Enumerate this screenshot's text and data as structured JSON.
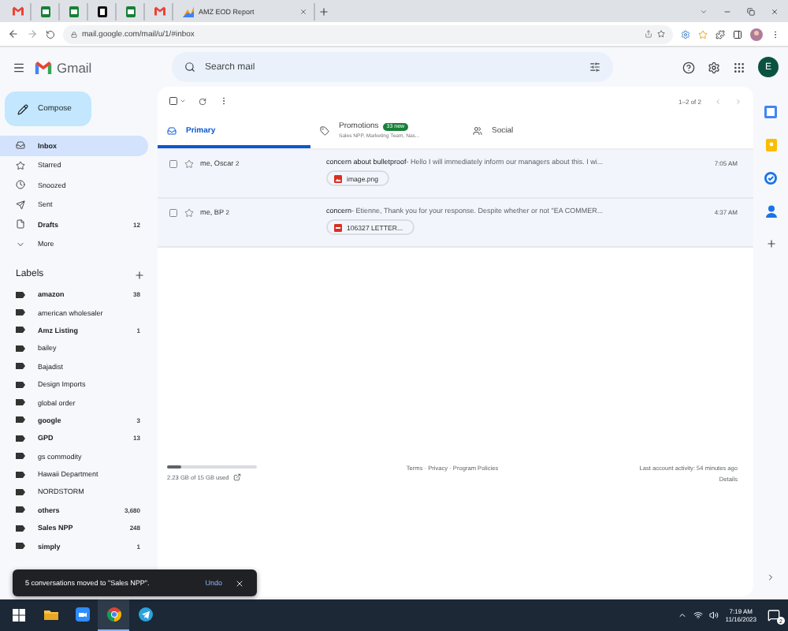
{
  "browser": {
    "tabs": [
      {
        "kind": "gmail"
      },
      {
        "kind": "sheets"
      },
      {
        "kind": "sheets"
      },
      {
        "kind": "notion"
      },
      {
        "kind": "sheets"
      },
      {
        "kind": "gmail"
      },
      {
        "kind": "report",
        "title": "AMZ EOD Report"
      }
    ],
    "url": "mail.google.com/mail/u/1/#inbox"
  },
  "header": {
    "product": "Gmail",
    "search": {
      "placeholder": "Search mail"
    },
    "avatar": "E"
  },
  "compose": "Compose",
  "nav": [
    {
      "kind": "inbox",
      "label": "Inbox",
      "selected": true,
      "unread": true
    },
    {
      "kind": "starred",
      "label": "Starred",
      "selected": false,
      "unread": false
    },
    {
      "kind": "snoozed",
      "label": "Snoozed",
      "selected": false,
      "unread": false
    },
    {
      "kind": "sent",
      "label": "Sent",
      "selected": false,
      "unread": false
    },
    {
      "kind": "drafts",
      "label": "Drafts",
      "count": "12",
      "selected": false,
      "unread": true
    },
    {
      "kind": "more",
      "label": "More",
      "selected": false,
      "unread": false
    }
  ],
  "labels_title": "Labels",
  "labels": [
    {
      "name": "amazon",
      "count": "38",
      "unread": true
    },
    {
      "name": "american wholesaler",
      "unread": false
    },
    {
      "name": "Amz Listing",
      "count": "1",
      "unread": true
    },
    {
      "name": "bailey",
      "unread": false
    },
    {
      "name": "Bajadist",
      "unread": false
    },
    {
      "name": "Design Imports",
      "unread": false
    },
    {
      "name": "global order",
      "unread": false
    },
    {
      "name": "google",
      "count": "3",
      "unread": true
    },
    {
      "name": "GPD",
      "count": "13",
      "unread": true
    },
    {
      "name": "gs commodity",
      "unread": false
    },
    {
      "name": "Hawaii Department",
      "unread": false
    },
    {
      "name": "NORDSTORM",
      "unread": false
    },
    {
      "name": "others",
      "count": "3,680",
      "unread": true
    },
    {
      "name": "Sales NPP",
      "count": "248",
      "unread": true
    },
    {
      "name": "simply",
      "count": "1",
      "unread": true
    }
  ],
  "pagination": "1–2 of 2",
  "inbox_tabs": [
    {
      "kind": "primary",
      "label": "Primary",
      "selected": true
    },
    {
      "kind": "promotions",
      "label": "Promotions",
      "badge": "33 new",
      "subtitle": "Sales NPP, Marketing Team, Nas...",
      "selected": false
    },
    {
      "kind": "social",
      "label": "Social",
      "selected": false
    }
  ],
  "emails": [
    {
      "sender": "me, Oscar",
      "count": "2",
      "subject": "concern about bulletproof",
      "snippet": " - Hello I will immediately inform our managers about this. I wi...",
      "time": "7:05 AM",
      "attachment": {
        "kind": "image",
        "name": "image.png"
      }
    },
    {
      "sender": "me, BP",
      "count": "2",
      "subject": "concern",
      "snippet": " - Etienne, Thank you for your response. Despite whether or not \"EA COMMER...",
      "time": "4:37 AM",
      "attachment": {
        "kind": "pdf",
        "name": "106327 LETTER..."
      }
    }
  ],
  "storage": {
    "level": 0.15,
    "text": "2.23 GB of 15 GB used"
  },
  "footer": {
    "links": "Terms · Privacy · Program Policies",
    "activity": "Last account activity: 54 minutes ago",
    "details": "Details"
  },
  "toast": {
    "message": "5 conversations moved to \"Sales NPP\".",
    "action": "Undo"
  },
  "taskbar": {
    "apps": [
      {
        "kind": "start",
        "selected": false
      },
      {
        "kind": "folder",
        "selected": false
      },
      {
        "kind": "zoom",
        "selected": false
      },
      {
        "kind": "chrome",
        "selected": true
      },
      {
        "kind": "telegram",
        "selected": false
      }
    ],
    "time": "7:19 AM",
    "date": "11/16/2023",
    "notifications": "2"
  }
}
